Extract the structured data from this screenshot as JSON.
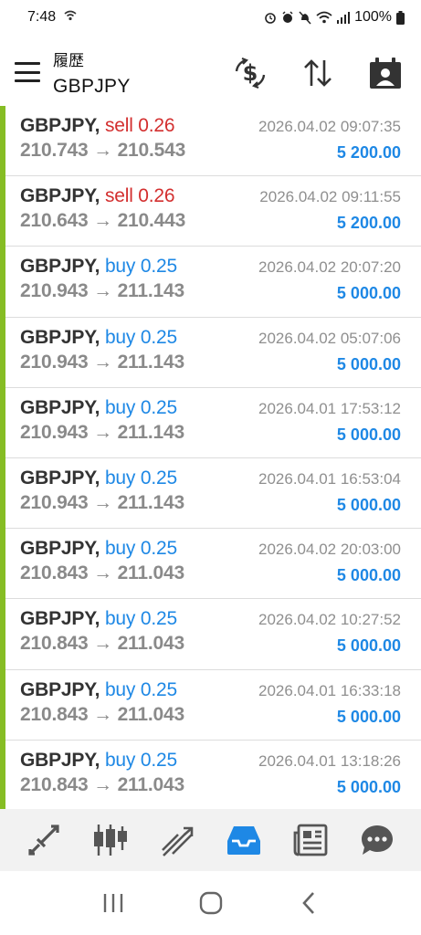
{
  "status_bar": {
    "time": "7:48",
    "battery": "100%"
  },
  "header": {
    "subtitle": "履歴",
    "title": "GBPJPY",
    "icons": [
      "currency-exchange-icon",
      "sort-icon",
      "calendar-icon"
    ]
  },
  "trades": [
    {
      "symbol": "GBPJPY,",
      "side": "sell 0.26",
      "type": "sell",
      "prices": "210.743 → 210.543",
      "time": "2026.04.02 09:07:35",
      "profit": "5 200.00"
    },
    {
      "symbol": "GBPJPY,",
      "side": "sell 0.26",
      "type": "sell",
      "prices": "210.643 → 210.443",
      "time": "2026.04.02 09:11:55",
      "profit": "5 200.00"
    },
    {
      "symbol": "GBPJPY,",
      "side": "buy 0.25",
      "type": "buy",
      "prices": "210.943 → 211.143",
      "time": "2026.04.02 20:07:20",
      "profit": "5 000.00"
    },
    {
      "symbol": "GBPJPY,",
      "side": "buy 0.25",
      "type": "buy",
      "prices": "210.943 → 211.143",
      "time": "2026.04.02 05:07:06",
      "profit": "5 000.00"
    },
    {
      "symbol": "GBPJPY,",
      "side": "buy 0.25",
      "type": "buy",
      "prices": "210.943 → 211.143",
      "time": "2026.04.01 17:53:12",
      "profit": "5 000.00"
    },
    {
      "symbol": "GBPJPY,",
      "side": "buy 0.25",
      "type": "buy",
      "prices": "210.943 → 211.143",
      "time": "2026.04.01 16:53:04",
      "profit": "5 000.00"
    },
    {
      "symbol": "GBPJPY,",
      "side": "buy 0.25",
      "type": "buy",
      "prices": "210.843 → 211.043",
      "time": "2026.04.02 20:03:00",
      "profit": "5 000.00"
    },
    {
      "symbol": "GBPJPY,",
      "side": "buy 0.25",
      "type": "buy",
      "prices": "210.843 → 211.043",
      "time": "2026.04.02 10:27:52",
      "profit": "5 000.00"
    },
    {
      "symbol": "GBPJPY,",
      "side": "buy 0.25",
      "type": "buy",
      "prices": "210.843 → 211.043",
      "time": "2026.04.01 16:33:18",
      "profit": "5 000.00"
    },
    {
      "symbol": "GBPJPY,",
      "side": "buy 0.25",
      "type": "buy",
      "prices": "210.843 → 211.043",
      "time": "2026.04.01 13:18:26",
      "profit": "5 000.00"
    }
  ],
  "bottom_nav": {
    "items": [
      "quotes-icon",
      "chart-icon",
      "trade-icon",
      "history-icon",
      "news-icon",
      "messages-icon"
    ],
    "active": "history-icon"
  },
  "colors": {
    "accent": "#1e88e5",
    "sell": "#d32f2f",
    "row_bar": "#86bd24",
    "muted": "#8a8a8a"
  }
}
